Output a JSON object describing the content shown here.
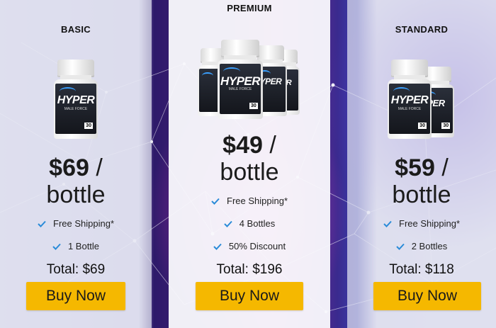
{
  "plans": [
    {
      "tier": "BASIC",
      "price": "$69",
      "separator": "/",
      "unit": "bottle",
      "features": [
        "Free Shipping*",
        "1 Bottle"
      ],
      "total": "Total: $69",
      "button": "Buy Now",
      "bottle_count": 1
    },
    {
      "tier": "PREMIUM",
      "price": "$49",
      "separator": "/",
      "unit": "bottle",
      "features": [
        "Free Shipping*",
        "4 Bottles",
        "50% Discount"
      ],
      "total": "Total: $196",
      "button": "Buy Now",
      "bottle_count": 4
    },
    {
      "tier": "STANDARD",
      "price": "$59",
      "separator": "/",
      "unit": "bottle",
      "features": [
        "Free Shipping*",
        "2 Bottles"
      ],
      "total": "Total: $118",
      "button": "Buy Now",
      "bottle_count": 2
    }
  ],
  "product": {
    "brand": "HYPER",
    "subtitle": "MALE FORCE",
    "capsules": "30"
  },
  "colors": {
    "button": "#f5b800",
    "check": "#2a8bd8",
    "label_accent": "#3aa0ff"
  },
  "icons": {
    "feature": "check-icon"
  }
}
